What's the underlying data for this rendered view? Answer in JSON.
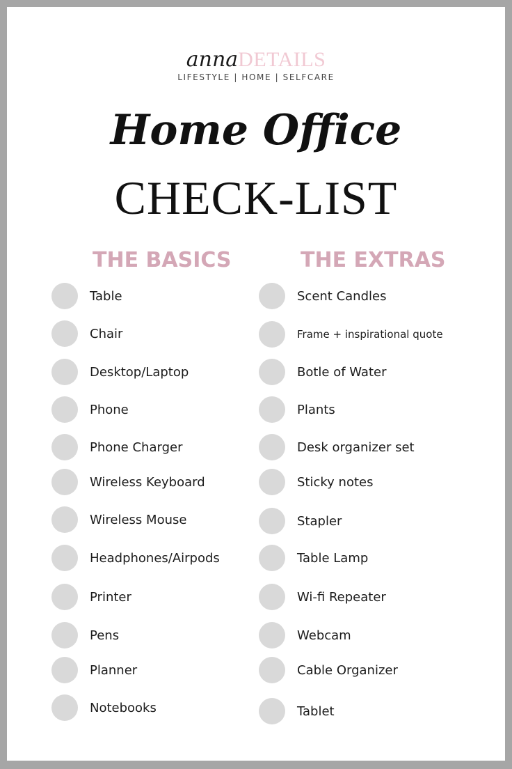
{
  "brand": {
    "name_script": "anna",
    "name_caps": "DETAILS",
    "tagline": "LIFESTYLE | HOME | SELFCARE",
    "accent_color": "#f1c9d3"
  },
  "title": {
    "script": "Home Office",
    "main": "CHECK-LIST"
  },
  "columns": [
    {
      "heading": "THE BASICS",
      "items": [
        {
          "label": "Table",
          "checked": false
        },
        {
          "label": "Chair",
          "checked": false
        },
        {
          "label": "Desktop/Laptop",
          "checked": false
        },
        {
          "label": "Phone",
          "checked": false
        },
        {
          "label": "Phone Charger",
          "checked": false
        },
        {
          "label": "Wireless Keyboard",
          "checked": false
        },
        {
          "label": "Wireless Mouse",
          "checked": false
        },
        {
          "label": "Headphones/Airpods",
          "checked": false
        },
        {
          "label": "Printer",
          "checked": false
        },
        {
          "label": "Pens",
          "checked": false
        },
        {
          "label": "Planner",
          "checked": false
        },
        {
          "label": "Notebooks",
          "checked": false
        }
      ]
    },
    {
      "heading": "THE EXTRAS",
      "items": [
        {
          "label": "Scent Candles",
          "checked": false
        },
        {
          "label": "Frame + inspirational quote",
          "checked": false
        },
        {
          "label": "Botle of Water",
          "checked": false
        },
        {
          "label": "Plants",
          "checked": false
        },
        {
          "label": "Desk organizer set",
          "checked": false
        },
        {
          "label": "Sticky notes",
          "checked": false
        },
        {
          "label": "Stapler",
          "checked": false
        },
        {
          "label": "Table Lamp",
          "checked": false
        },
        {
          "label": "Wi-fi Repeater",
          "checked": false
        },
        {
          "label": "Webcam",
          "checked": false
        },
        {
          "label": "Cable Organizer",
          "checked": false
        },
        {
          "label": "Tablet",
          "checked": false
        }
      ]
    }
  ],
  "colors": {
    "heading": "#d4a7b6",
    "checkbox": "#d9d9d9",
    "frame": "#a6a6a6"
  }
}
